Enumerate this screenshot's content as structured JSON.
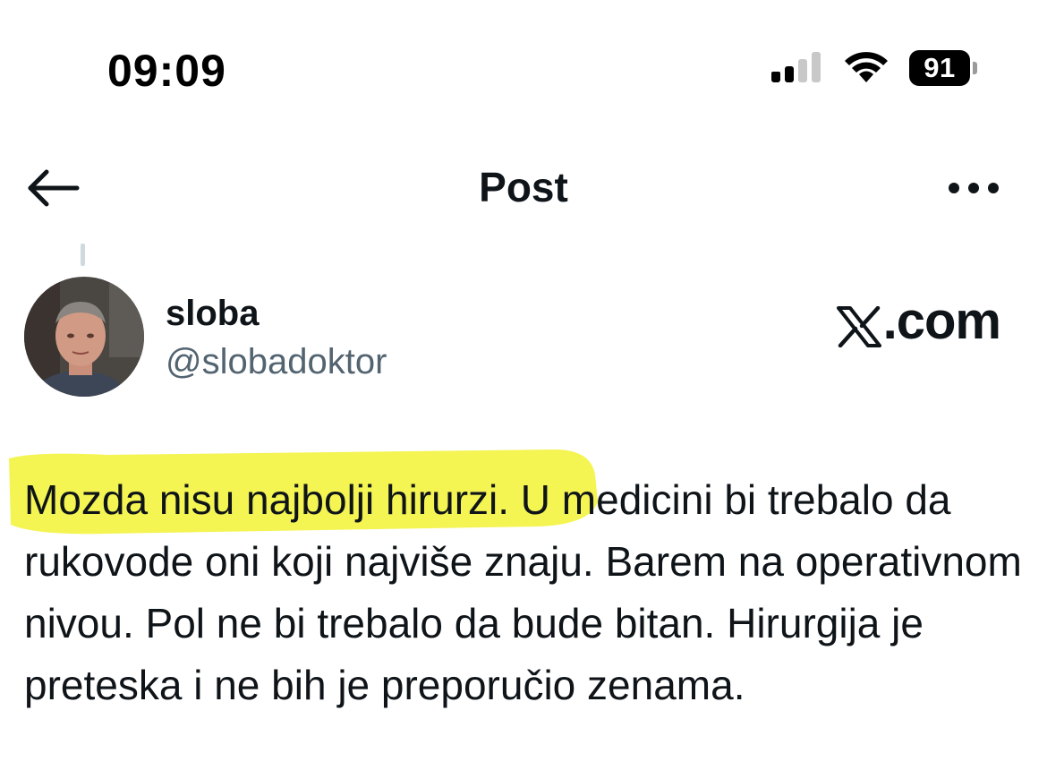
{
  "status_bar": {
    "time": "09:09",
    "battery": "91",
    "icons": [
      "signal-icon",
      "wifi-icon",
      "battery-icon"
    ]
  },
  "header": {
    "title": "Post",
    "back_icon": "arrow-left-icon",
    "more_icon": "more-horizontal-icon"
  },
  "author": {
    "display_name": "sloba",
    "handle": "@slobadoktor"
  },
  "watermark": {
    "text": ".com",
    "logo_letter": "X"
  },
  "post": {
    "text": "Mozda nisu najbolji hirurzi. U medicini bi trebalo da rukovode oni koji najviše znaju. Barem na operativnom nivou. Pol ne bi trebalo da bude bitan. Hirurgija je preteska i ne bih je preporučio zenama.",
    "highlight_color": "#f2f23a"
  }
}
